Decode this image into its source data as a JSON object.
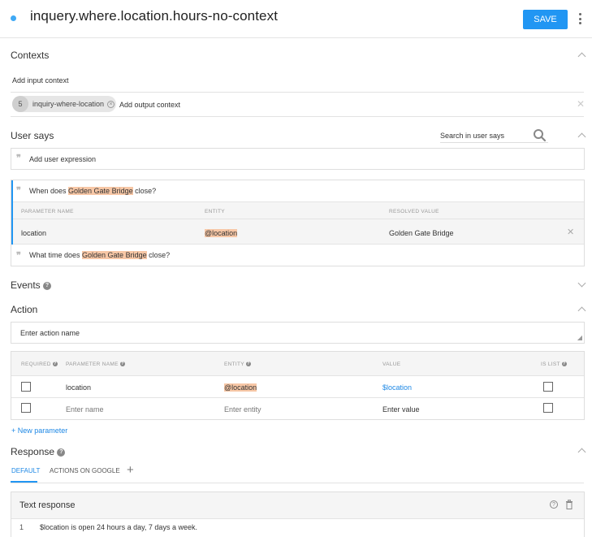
{
  "header": {
    "intent_name": "inquery.where.location.hours-no-context",
    "save_label": "SAVE"
  },
  "contexts": {
    "title": "Contexts",
    "input_placeholder": "Add input context",
    "output_context": {
      "lifespan": "5",
      "name": "inquiry-where-location"
    },
    "output_placeholder": "Add output context"
  },
  "user_says": {
    "title": "User says",
    "search_placeholder": "Search in user says",
    "add_placeholder": "Add user expression",
    "expressions": [
      {
        "before": "When does ",
        "highlight": "Golden Gate Bridge",
        "after": " close?"
      },
      {
        "before": "What time does ",
        "highlight": "Golden Gate Bridge",
        "after": " close?"
      }
    ],
    "param_table": {
      "headers": [
        "PARAMETER NAME",
        "ENTITY",
        "RESOLVED VALUE"
      ],
      "row": {
        "name": "location",
        "entity": "@location",
        "resolved": "Golden Gate Bridge"
      }
    }
  },
  "events": {
    "title": "Events"
  },
  "action": {
    "title": "Action",
    "action_placeholder": "Enter action name",
    "headers": {
      "required": "REQUIRED",
      "param_name": "PARAMETER NAME",
      "entity": "ENTITY",
      "value": "VALUE",
      "is_list": "IS LIST"
    },
    "rows": [
      {
        "name": "location",
        "entity": "@location",
        "value": "$location"
      }
    ],
    "new_row": {
      "name_placeholder": "Enter name",
      "entity_placeholder": "Enter entity",
      "value_placeholder": "Enter value"
    },
    "new_parameter_label": "+ New parameter"
  },
  "response": {
    "title": "Response",
    "tabs": [
      "DEFAULT",
      "ACTIONS ON GOOGLE"
    ],
    "card_title": "Text response",
    "lines": [
      {
        "num": "1",
        "text": "$location is open 24 hours a day, 7 days a week."
      }
    ]
  },
  "colors": {
    "accent": "#2196f3",
    "highlight": "#f7c7a6",
    "link": "#1e88e5"
  }
}
